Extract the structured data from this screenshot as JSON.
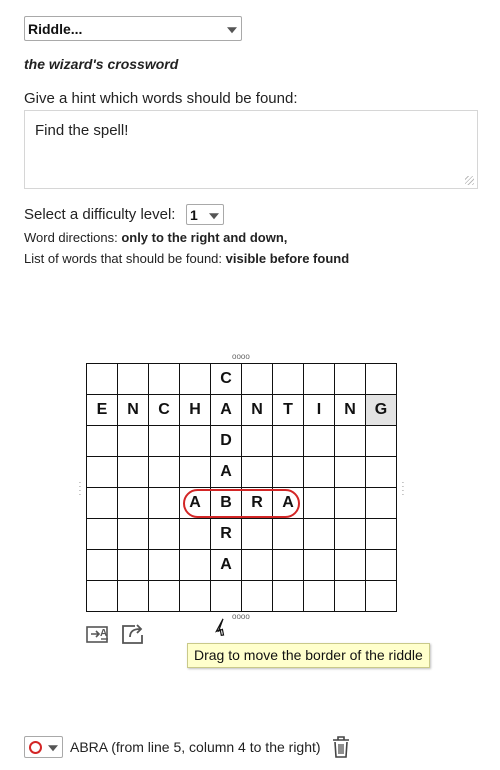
{
  "riddle_select": {
    "value": "Riddle..."
  },
  "subtitle": "the wizard's crossword",
  "hint": {
    "label": "Give a hint which words should be found:",
    "value": "Find the spell!"
  },
  "difficulty": {
    "label": "Select a difficulty level:",
    "value": "1"
  },
  "info": {
    "directions_label": "Word directions:",
    "directions_value": "only to the right and down,",
    "list_label": "List of words that should be found:",
    "list_value": "visible before found"
  },
  "grid": {
    "rows": [
      [
        "",
        "",
        "",
        "",
        "C",
        "",
        "",
        "",
        "",
        ""
      ],
      [
        "E",
        "N",
        "C",
        "H",
        "A",
        "N",
        "T",
        "I",
        "N",
        "G"
      ],
      [
        "",
        "",
        "",
        "",
        "D",
        "",
        "",
        "",
        "",
        ""
      ],
      [
        "",
        "",
        "",
        "",
        "A",
        "",
        "",
        "",
        "",
        ""
      ],
      [
        "",
        "",
        "",
        "A",
        "B",
        "R",
        "A",
        "",
        "",
        ""
      ],
      [
        "",
        "",
        "",
        "",
        "R",
        "",
        "",
        "",
        "",
        ""
      ],
      [
        "",
        "",
        "",
        "",
        "A",
        "",
        "",
        "",
        "",
        ""
      ],
      [
        "",
        "",
        "",
        "",
        "",
        "",
        "",
        "",
        "",
        ""
      ]
    ]
  },
  "highlight_color": "#d32626",
  "handles": {
    "glyph": "oooo"
  },
  "icons": {
    "edit": "text-edit-icon",
    "export": "export-icon",
    "cursor": "pointer-cursor-icon",
    "delete": "trash-icon",
    "color": "red-ring-icon"
  },
  "tooltip": "Drag to move the border of the riddle",
  "found_words": [
    {
      "text": "ABRA (from line 5, column 4 to the right)"
    }
  ]
}
